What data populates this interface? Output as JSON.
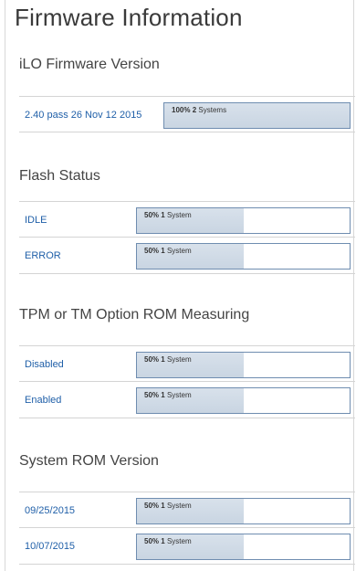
{
  "title": "Firmware Information",
  "sections": [
    {
      "title": "iLO Firmware Version",
      "rows": [
        {
          "label": "2.40 pass 26 Nov 12 2015",
          "percent": "100%",
          "count": "2",
          "unit": "Systems",
          "fill": 1.0
        }
      ]
    },
    {
      "title": "Flash Status",
      "rows": [
        {
          "label": "IDLE",
          "percent": "50%",
          "count": "1",
          "unit": "System",
          "fill": 0.5
        },
        {
          "label": "ERROR",
          "percent": "50%",
          "count": "1",
          "unit": "System",
          "fill": 0.5
        }
      ]
    },
    {
      "title": "TPM or TM Option ROM Measuring",
      "rows": [
        {
          "label": "Disabled",
          "percent": "50%",
          "count": "1",
          "unit": "System",
          "fill": 0.5
        },
        {
          "label": "Enabled",
          "percent": "50%",
          "count": "1",
          "unit": "System",
          "fill": 0.5
        }
      ]
    },
    {
      "title": "System ROM Version",
      "rows": [
        {
          "label": "09/25/2015",
          "percent": "50%",
          "count": "1",
          "unit": "System",
          "fill": 0.5
        },
        {
          "label": "10/07/2015",
          "percent": "50%",
          "count": "1",
          "unit": "System",
          "fill": 0.5
        }
      ]
    }
  ]
}
